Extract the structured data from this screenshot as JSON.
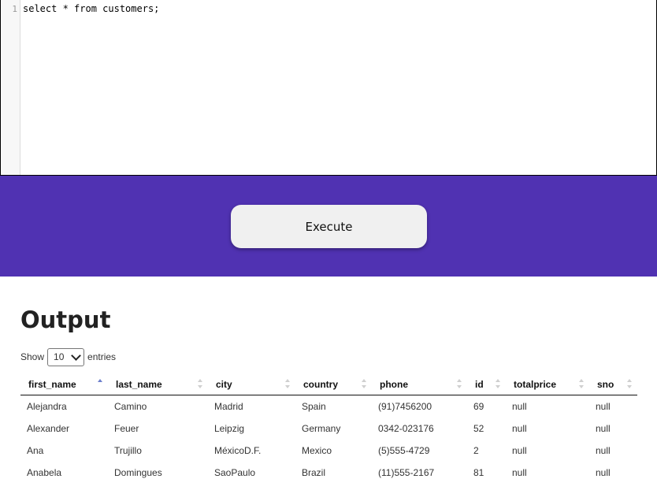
{
  "editor": {
    "line_number": "1",
    "code": "select * from customers;"
  },
  "toolbar": {
    "execute_label": "Execute",
    "band_color": "#5032b2"
  },
  "output": {
    "title": "Output",
    "show_label": "Show",
    "entries_label": "entries",
    "page_length": "10",
    "columns": [
      "first_name",
      "last_name",
      "city",
      "country",
      "phone",
      "id",
      "totalprice",
      "sno"
    ],
    "sorted_column": "first_name",
    "sort_direction": "ascending",
    "rows": [
      [
        "Alejandra",
        "Camino",
        "Madrid",
        "Spain",
        "(91)7456200",
        "69",
        "null",
        "null"
      ],
      [
        "Alexander",
        "Feuer",
        "Leipzig",
        "Germany",
        "0342-023176",
        "52",
        "null",
        "null"
      ],
      [
        "Ana",
        "Trujillo",
        "MéxicoD.F.",
        "Mexico",
        "(5)555-4729",
        "2",
        "null",
        "null"
      ],
      [
        "Anabela",
        "Domingues",
        "SaoPaulo",
        "Brazil",
        "(11)555-2167",
        "81",
        "null",
        "null"
      ]
    ]
  }
}
